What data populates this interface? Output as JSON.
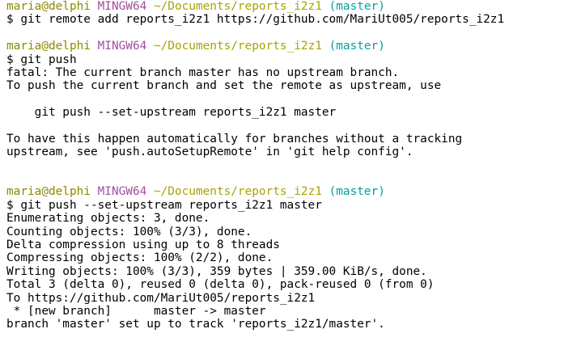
{
  "colors": {
    "background": "#ffffff",
    "text": "#000000",
    "user_host": "#8a8a00",
    "shell": "#a050a0",
    "path": "#a5a500",
    "branch": "#00a0a0"
  },
  "prompts": [
    {
      "user_host": "maria@delphi",
      "shell": "MINGW64",
      "path": "~/Documents/reports_i2z1",
      "branch": "(master)",
      "command": "$ git remote add reports_i2z1 https://github.com/MariUt005/reports_i2z1"
    },
    {
      "user_host": "maria@delphi",
      "shell": "MINGW64",
      "path": "~/Documents/reports_i2z1",
      "branch": "(master)",
      "command": "$ git push"
    },
    {
      "user_host": "maria@delphi",
      "shell": "MINGW64",
      "path": "~/Documents/reports_i2z1",
      "branch": "(master)",
      "command": "$ git push --set-upstream reports_i2z1 master"
    }
  ],
  "output": {
    "push_error": [
      "fatal: The current branch master has no upstream branch.",
      "To push the current branch and set the remote as upstream, use",
      "",
      "    git push --set-upstream reports_i2z1 master",
      "",
      "To have this happen automatically for branches without a tracking",
      "upstream, see 'push.autoSetupRemote' in 'git help config'."
    ],
    "push_success": [
      "Enumerating objects: 3, done.",
      "Counting objects: 100% (3/3), done.",
      "Delta compression using up to 8 threads",
      "Compressing objects: 100% (2/2), done.",
      "Writing objects: 100% (3/3), 359 bytes | 359.00 KiB/s, done.",
      "Total 3 (delta 0), reused 0 (delta 0), pack-reused 0 (from 0)",
      "To https://github.com/MariUt005/reports_i2z1",
      " * [new branch]      master -> master",
      "branch 'master' set up to track 'reports_i2z1/master'."
    ]
  }
}
